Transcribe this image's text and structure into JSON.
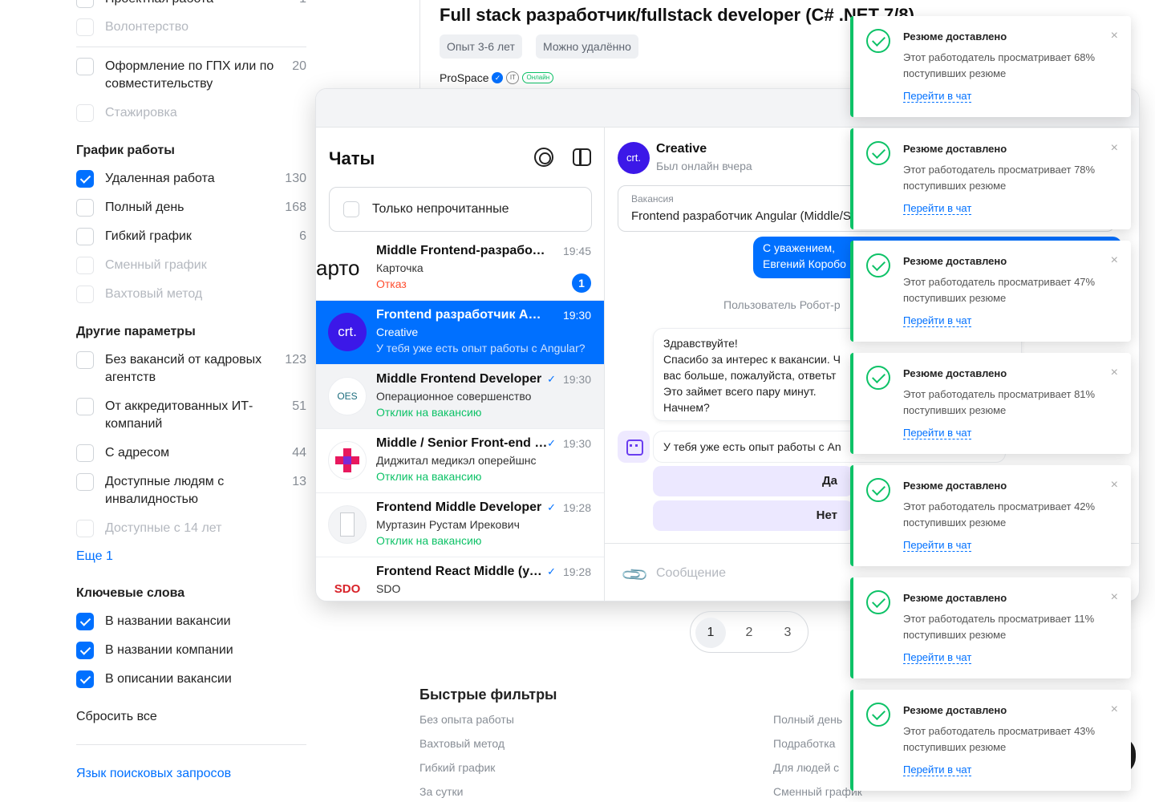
{
  "filters": {
    "top_partial": {
      "label": "Проектная работа",
      "count": "1"
    },
    "volunteer": {
      "label": "Волонтерство"
    },
    "gph": {
      "label": "Оформление по ГПХ или по совместительству",
      "count": "20"
    },
    "intern": {
      "label": "Стажировка"
    },
    "schedule": {
      "title": "График работы",
      "items": [
        {
          "label": "Удаленная работа",
          "count": "130",
          "checked": true
        },
        {
          "label": "Полный день",
          "count": "168"
        },
        {
          "label": "Гибкий график",
          "count": "6"
        },
        {
          "label": "Сменный график",
          "count": ""
        },
        {
          "label": "Вахтовый метод",
          "count": ""
        }
      ]
    },
    "other": {
      "title": "Другие параметры",
      "items": [
        {
          "label": "Без вакансий от кадровых агентств",
          "count": "123"
        },
        {
          "label": "От аккредитованных ИТ-компаний",
          "count": "51"
        },
        {
          "label": "С адресом",
          "count": "44"
        },
        {
          "label": "Доступные людям с инвалидностью",
          "count": "13"
        },
        {
          "label": "Доступные с 14 лет",
          "count": ""
        }
      ],
      "more": "Еще 1"
    },
    "keywords": {
      "title": "Ключевые слова",
      "items": [
        {
          "label": "В названии вакансии",
          "checked": true
        },
        {
          "label": "В названии компании",
          "checked": true
        },
        {
          "label": "В описании вакансии",
          "checked": true
        }
      ]
    },
    "reset": "Сбросить все",
    "query_lang": "Язык поисковых запросов"
  },
  "vacancy": {
    "title": "Full stack разработчик/fullstack developer (C# .NET 7/8)",
    "experience": "Опыт 3-6 лет",
    "remote": "Можно удалённо",
    "company": "ProSpace",
    "it_badge": "IT",
    "online_badge": "Онлайн"
  },
  "chats": {
    "title": "Чаты",
    "unread_only": "Только непрочитанные",
    "items": [
      {
        "avatar": "арто",
        "name": "Middle Frontend-разработчик",
        "time": "19:45",
        "sub": "Карточка",
        "status": "Отказ",
        "status_color": "#ff4d2e",
        "badge": "1"
      },
      {
        "avatar": "crt.",
        "name": "Frontend разработчик Angular (Middle/Senior)",
        "time": "19:30",
        "sub": "Creative",
        "status": "У тебя уже есть опыт работы с Angular?",
        "active": true
      },
      {
        "avatar": "OES",
        "name": "Middle Frontend Developer",
        "time": "19:30",
        "sub": "Операционное совершенство",
        "status": "Отклик на вакансию",
        "status_color": "#0dc267",
        "read": true
      },
      {
        "avatar": "",
        "name": "Middle / Senior Front-end developer",
        "time": "19:30",
        "sub": "Диджитал медикэл оперейшнс",
        "status": "Отклик на вакансию",
        "status_color": "#0dc267",
        "read": true
      },
      {
        "avatar": "",
        "name": "Frontend Middle Developer",
        "time": "19:28",
        "sub": "Муртазин Рустам Ирекович",
        "status": "Отклик на вакансию",
        "status_color": "#0dc267",
        "read": true
      },
      {
        "avatar": "SDO",
        "name": "Frontend React Middle (удаленно)",
        "time": "19:28",
        "sub": "SDO",
        "status": "",
        "read": true
      }
    ],
    "read_mark": "✓"
  },
  "conversation": {
    "avatar": "crt.",
    "name": "Creative",
    "seen": "Был онлайн вчера",
    "vacancy_caption": "Вакансия",
    "vacancy_value": "Frontend разработчик Angular (Middle/S",
    "my_message": "С уважением,\nЕвгений Коробо",
    "system": "Пользователь Робот-р",
    "incoming": "Здравствуйте!\nСпасибо за интерес к вакансии. Ч\nвас больше, пожалуйста, ответьт\nЭто займет всего пару минут.\nНачнем?",
    "question": "У тебя уже есть опыт работы с An",
    "option_yes": "Да",
    "option_no": "Нет",
    "placeholder": "Сообщение"
  },
  "pagination": [
    "1",
    "2",
    "3"
  ],
  "quick_filters": {
    "title": "Быстрые фильтры",
    "left": [
      "Без опыта работы",
      "Вахтовый метод",
      "Гибкий график",
      "За сутки"
    ],
    "right": [
      "Полный день",
      "Подработка",
      "Для людей с",
      "Сменный график"
    ]
  },
  "toasts": {
    "title": "Резюме доставлено",
    "prefix": "Этот работодатель просматривает",
    "link": "Перейти в чат",
    "close": "×",
    "items": [
      {
        "text": "68% поступивших резюме"
      },
      {
        "text": "78% поступивших резюме"
      },
      {
        "text": "47% поступивших резюме"
      },
      {
        "text": "81% поступивших резюме"
      },
      {
        "text": "42% поступивших резюме"
      },
      {
        "text": "11% поступивших резюме"
      },
      {
        "text": "43% поступивших резюме"
      }
    ]
  },
  "colors": {
    "accent": "#0070ff",
    "success": "#0dc267",
    "danger": "#ff4d2e",
    "bot": "#6a3df0"
  }
}
